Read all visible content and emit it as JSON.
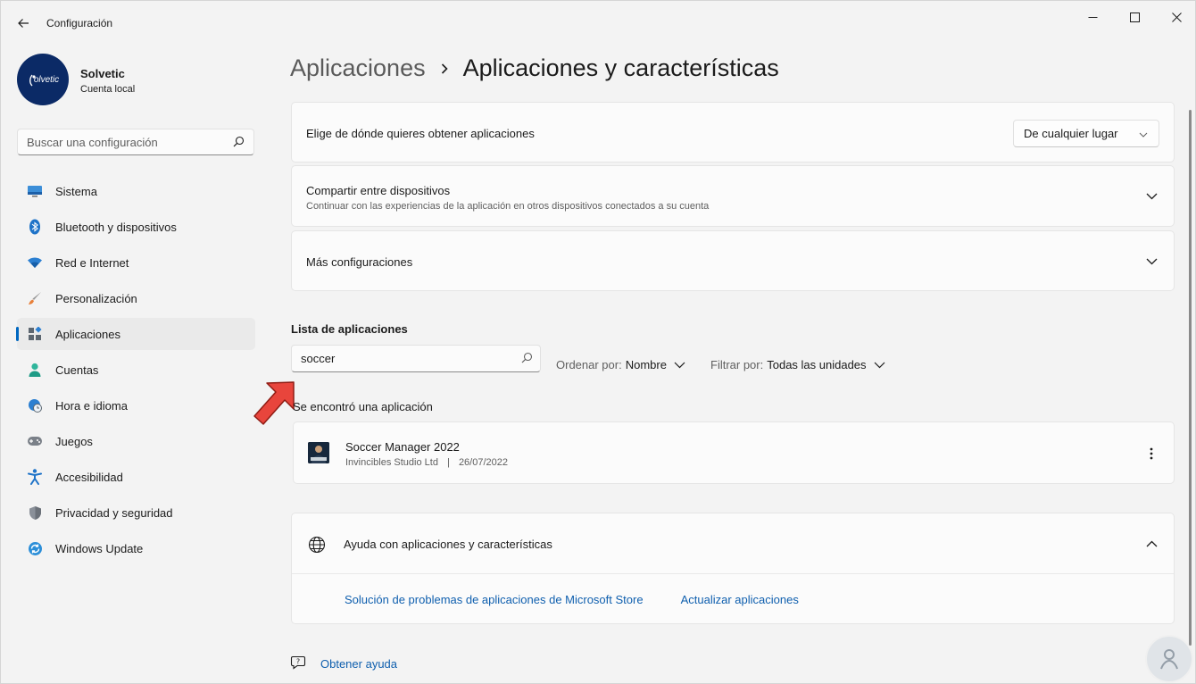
{
  "window": {
    "title": "Configuración"
  },
  "profile": {
    "name": "Solvetic",
    "account_type": "Cuenta local",
    "avatar_text": "olvetic"
  },
  "search": {
    "placeholder": "Buscar una configuración"
  },
  "sidebar": {
    "items": [
      {
        "label": "Sistema",
        "icon": "monitor-icon"
      },
      {
        "label": "Bluetooth y dispositivos",
        "icon": "bluetooth-icon"
      },
      {
        "label": "Red e Internet",
        "icon": "wifi-icon"
      },
      {
        "label": "Personalización",
        "icon": "brush-icon"
      },
      {
        "label": "Aplicaciones",
        "icon": "apps-icon",
        "active": true
      },
      {
        "label": "Cuentas",
        "icon": "person-icon"
      },
      {
        "label": "Hora e idioma",
        "icon": "clock-globe-icon"
      },
      {
        "label": "Juegos",
        "icon": "gamepad-icon"
      },
      {
        "label": "Accesibilidad",
        "icon": "accessibility-icon"
      },
      {
        "label": "Privacidad y seguridad",
        "icon": "shield-icon"
      },
      {
        "label": "Windows Update",
        "icon": "update-icon"
      }
    ]
  },
  "breadcrumb": {
    "parent": "Aplicaciones",
    "current": "Aplicaciones y características"
  },
  "settings": {
    "source": {
      "title": "Elige de dónde quieres obtener aplicaciones",
      "value": "De cualquier lugar"
    },
    "share": {
      "title": "Compartir entre dispositivos",
      "subtitle": "Continuar con las experiencias de la aplicación en otros dispositivos conectados a su cuenta"
    },
    "more": {
      "title": "Más configuraciones"
    }
  },
  "app_list": {
    "title": "Lista de aplicaciones",
    "search_value": "soccer",
    "sort_label": "Ordenar por:",
    "sort_value": "Nombre",
    "filter_label": "Filtrar por:",
    "filter_value": "Todas las unidades",
    "result_text": "Se encontró una aplicación",
    "apps": [
      {
        "name": "Soccer Manager 2022",
        "publisher": "Invincibles Studio Ltd",
        "separator": "|",
        "date": "26/07/2022"
      }
    ]
  },
  "help": {
    "title": "Ayuda con aplicaciones y características",
    "links": [
      "Solución de problemas de aplicaciones de Microsoft Store",
      "Actualizar aplicaciones"
    ]
  },
  "footer": {
    "get_help": "Obtener ayuda"
  },
  "colors": {
    "accent": "#0067c0",
    "link": "#0f5fae",
    "arrow": "#e8453c"
  }
}
